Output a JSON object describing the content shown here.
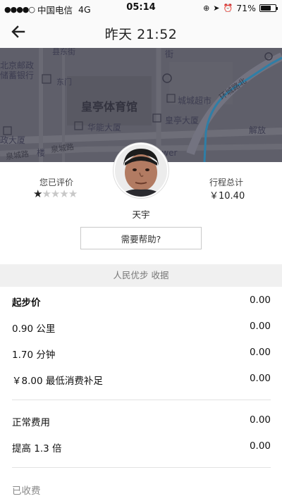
{
  "status_bar": {
    "carrier": "中国电信",
    "network": "4G",
    "time": "05:14",
    "battery": "71%",
    "battery_level": 0.71
  },
  "nav": {
    "title": "昨天 21:52",
    "back_icon": "arrow-left-icon"
  },
  "map": {
    "labels": [
      "县东街",
      "北京邮政",
      "储蓄银行",
      "东门",
      "皇亭体育馆",
      "城城超市",
      "华能大厦",
      "皇亭大厦",
      "环城路北",
      "政大厦",
      "泉城路",
      "泉城路",
      "解放",
      "楼",
      "ower",
      "街"
    ]
  },
  "driver": {
    "rated_label": "您已评价",
    "rating": 1,
    "max_rating": 5,
    "trip_total_label": "行程总计",
    "trip_total": "￥10.40",
    "name": "天宇"
  },
  "help_button": "需要帮助?",
  "receipt_header": "人民优步 收据",
  "fare_items": [
    {
      "label": "起步价",
      "amount": "0.00"
    },
    {
      "label": "0.90 公里",
      "amount": "0.00"
    },
    {
      "label": "1.70 分钟",
      "amount": "0.00"
    },
    {
      "label": "￥8.00 最低消费补足",
      "amount": "0.00"
    }
  ],
  "fare_items_2": [
    {
      "label": "正常费用",
      "amount": "0.00"
    },
    {
      "label": "提高 1.3 倍",
      "amount": "0.00"
    }
  ],
  "collected_label": "已收费"
}
